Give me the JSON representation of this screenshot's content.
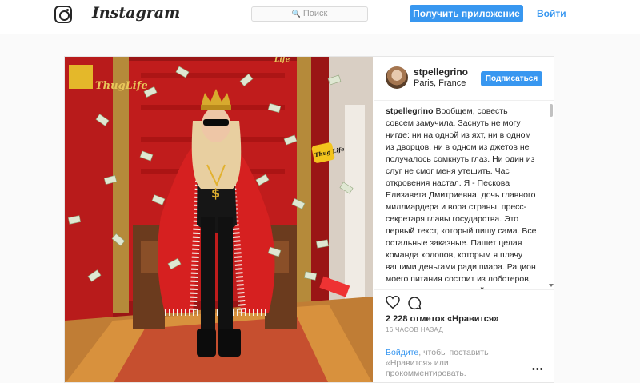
{
  "header": {
    "wordmark": "Instagram",
    "search_placeholder": "Поиск",
    "get_app_label": "Получить приложение",
    "login_label": "Войти"
  },
  "post": {
    "photo_overlay_text": {
      "sign_left": "ThugLife",
      "sign_right": "Life",
      "badge": "Thug Life"
    },
    "author": {
      "username": "stpellegrino",
      "location": "Paris, France",
      "follow_label": "Подписаться"
    },
    "caption": {
      "username": "stpellegrino",
      "text": "Вообщем, совесть совсем замучила. Заснуть не могу нигде: ни на одной из яхт, ни в одном из дворцов, ни в одном из джетов не получалось сомкнуть глаз. Ни один из слуг не смог меня утешить. Час откровения настал. Я - Пескова Елизавета Дмитриевна, дочь главного миллиардера и вора страны, пресс-секретаря главы государства. Это первый текст, который пишу сама. Все остальные заказные. Пашет целая команда холопов, которым я плачу вашими деньгами ради пиара. Рацион моего питания состоит из лобстеров, посыпанных макадамией и шафраном, заваленных икрой белуги - альбиноса, и девонских крабов. Короче говоря, из всего, что вам не по карману, так как"
    },
    "likes_text": "2 228 отметок «Нравится»",
    "time_text": "16 ЧАСОВ НАЗАД",
    "login_prompt": {
      "link": "Войдите",
      "rest": ", чтобы поставить «Нравится» или прокомментировать.",
      "more": "•••"
    }
  },
  "colors": {
    "accent": "#3897f0",
    "text": "#262626",
    "muted": "#999999",
    "border": "#dbdbdb"
  }
}
